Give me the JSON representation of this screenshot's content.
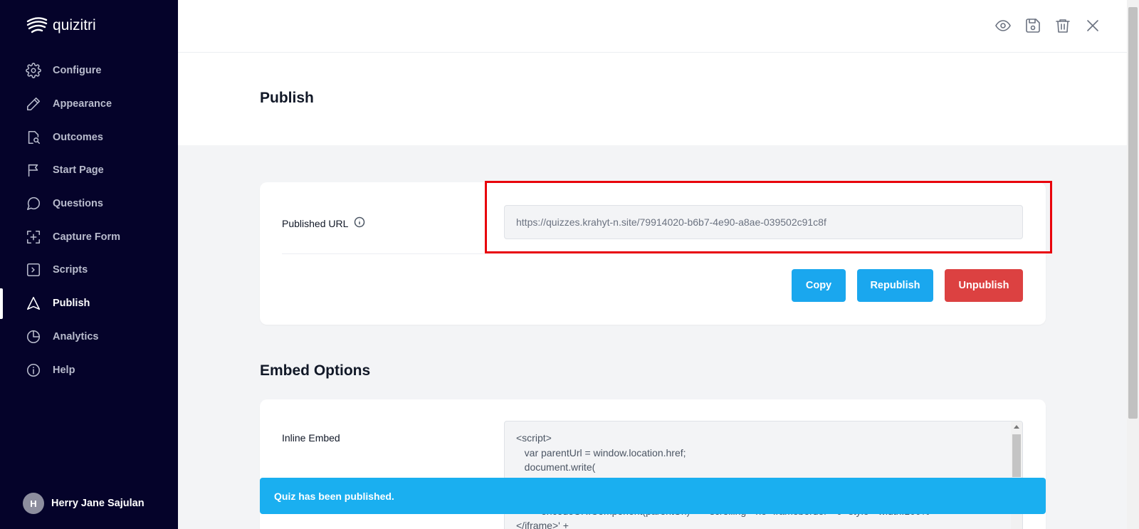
{
  "app": {
    "logo_text": "quizitri"
  },
  "sidebar": {
    "items": [
      {
        "label": "Configure",
        "icon": "gear-icon"
      },
      {
        "label": "Appearance",
        "icon": "pencil-icon"
      },
      {
        "label": "Outcomes",
        "icon": "document-search-icon"
      },
      {
        "label": "Start Page",
        "icon": "flag-icon"
      },
      {
        "label": "Questions",
        "icon": "chat-bubble-icon"
      },
      {
        "label": "Capture Form",
        "icon": "capture-plus-icon"
      },
      {
        "label": "Scripts",
        "icon": "terminal-icon"
      },
      {
        "label": "Publish",
        "icon": "navigation-arrow-icon",
        "active": true
      },
      {
        "label": "Analytics",
        "icon": "pie-chart-icon"
      },
      {
        "label": "Help",
        "icon": "info-icon"
      }
    ],
    "user": {
      "initial": "H",
      "name": "Herry Jane Sajulan"
    }
  },
  "toolbar": {
    "icons": [
      "eye-icon",
      "save-icon",
      "trash-icon",
      "close-icon"
    ]
  },
  "main": {
    "title": "Publish",
    "published_url": {
      "label": "Published URL",
      "value": "https://quizzes.krahyt-n.site/79914020-b6b7-4e90-a8ae-039502c91c8f"
    },
    "buttons": {
      "copy": "Copy",
      "republish": "Republish",
      "unpublish": "Unpublish"
    },
    "embed_section_title": "Embed Options",
    "inline_embed": {
      "label": "Inline Embed",
      "code": "<script>\n   var parentUrl = window.location.href;\n   document.write(\n\n\n         encodeURIComponent(parentUrl) + '\" scrolling=\"no\" frameborder=\"0\" style=\"width:100%\n</iframe>' +"
    }
  },
  "toast": {
    "message": "Quiz has been published."
  },
  "colors": {
    "sidebar_bg": "#05032a",
    "primary": "#1aa7ee",
    "danger": "#dc4141",
    "highlight": "#e8000b"
  }
}
